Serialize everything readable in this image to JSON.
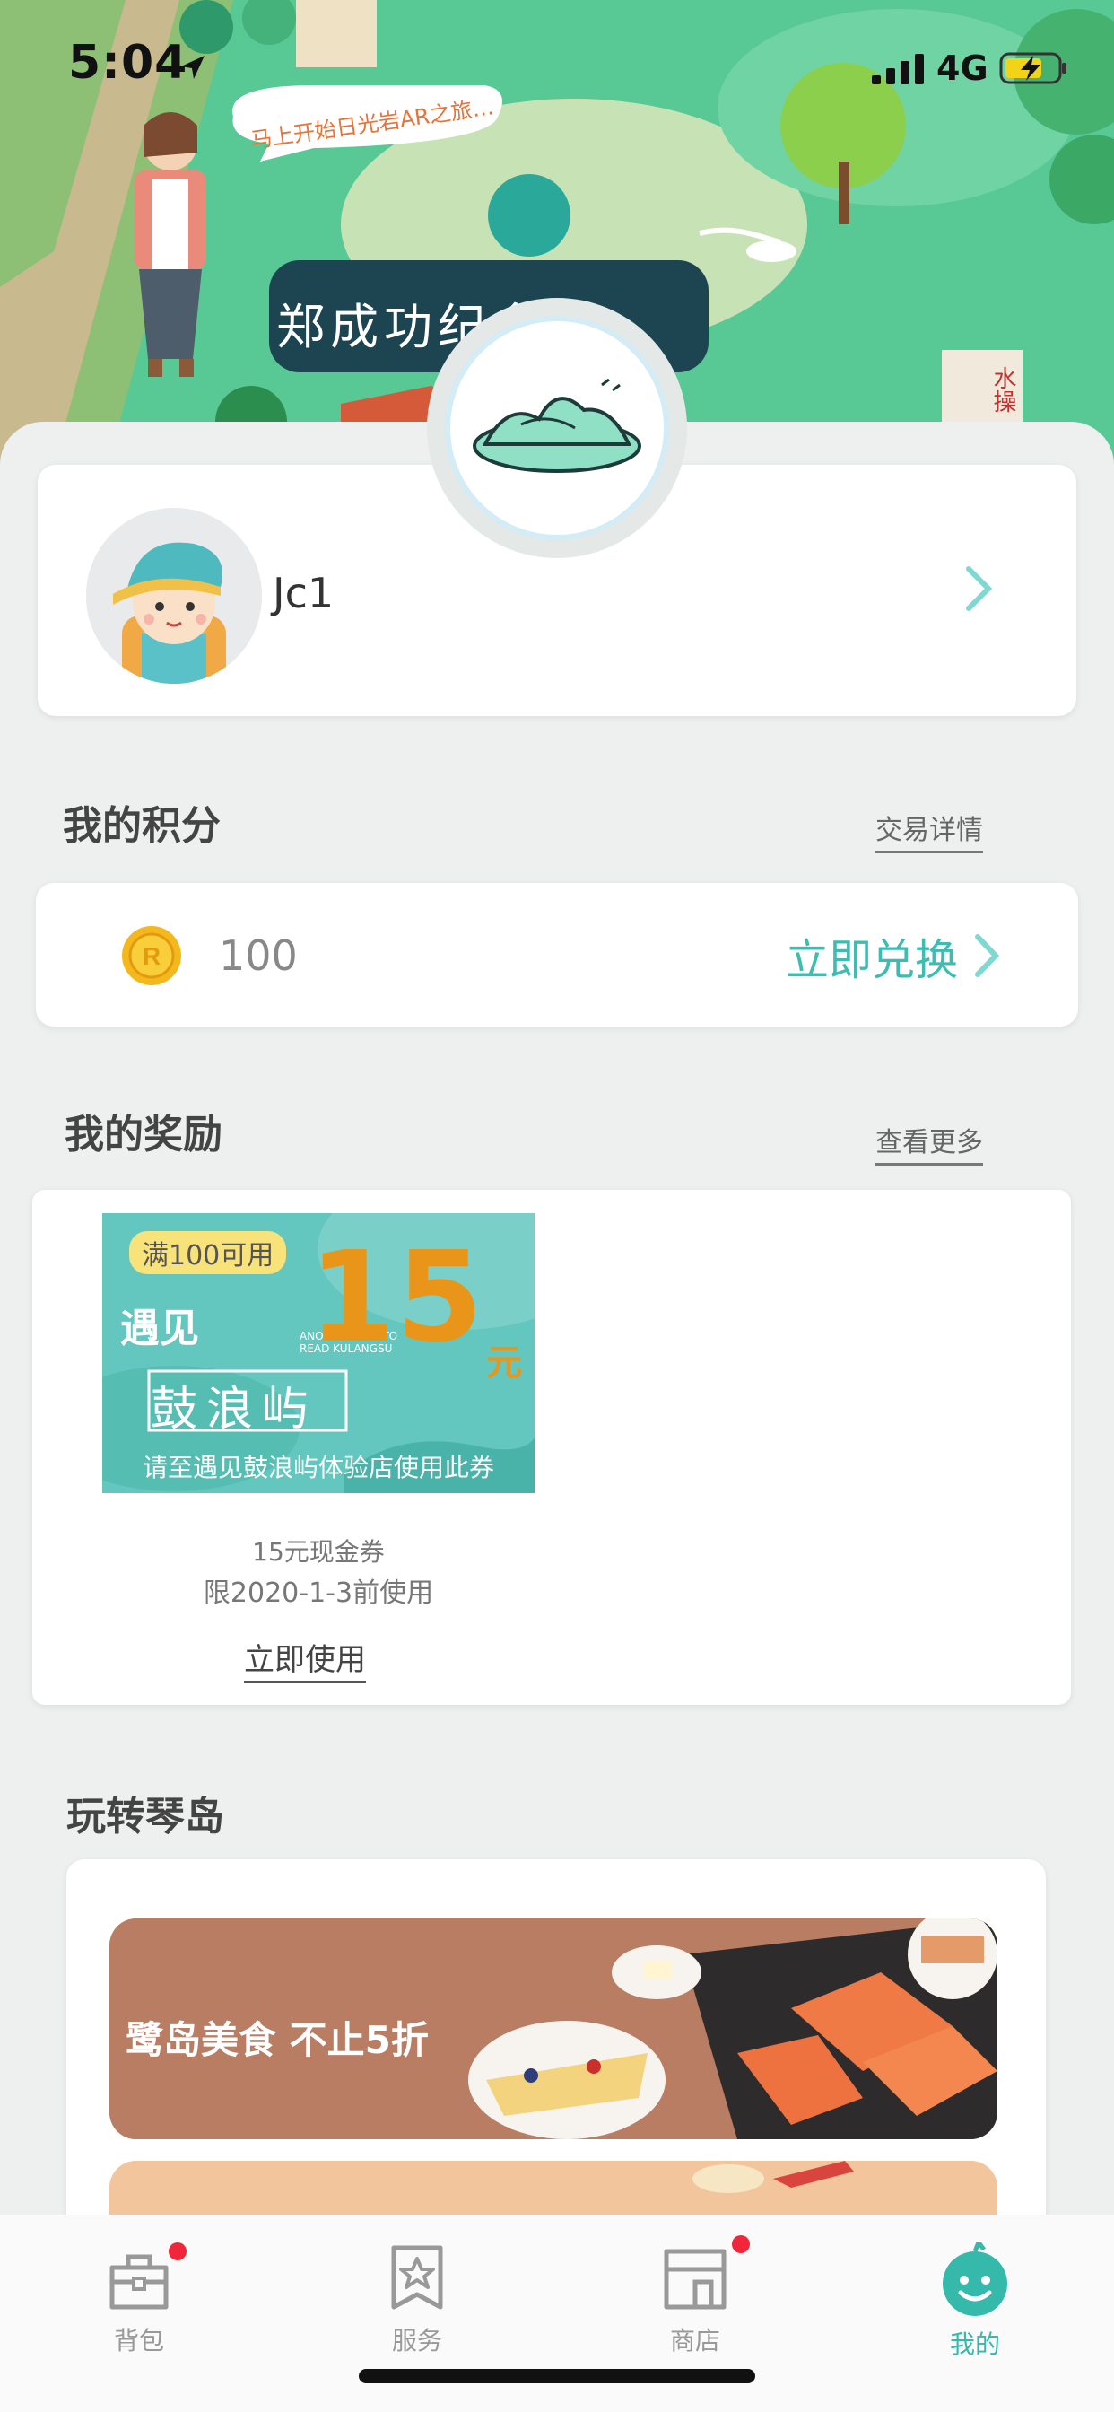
{
  "status_bar": {
    "time": "5:04",
    "network": "4G"
  },
  "header": {
    "speech_bubble": "马上开始日光岩AR之旅…",
    "museum_sign": "郑成功纪念馆",
    "side_sign": "水操"
  },
  "profile": {
    "username": "Jc1"
  },
  "points": {
    "section_title": "我的积分",
    "details_link": "交易详情",
    "value": "100",
    "redeem_label": "立即兑换"
  },
  "rewards": {
    "section_title": "我的奖励",
    "more_link": "查看更多",
    "coupon": {
      "condition": "满100可用",
      "amount": "15",
      "unit": "元",
      "brand_line1": "遇见",
      "brand_line2": "鼓浪屿",
      "sub_text": "ANOTHER WAY TO READ KULANGSU",
      "note": "请至遇见鼓浪屿体验店使用此券",
      "name": "15元现金券",
      "expiry": "限2020-1-3前使用",
      "use_label": "立即使用"
    }
  },
  "explore": {
    "section_title": "玩转琴岛",
    "banner1_text": "鹭岛美食 不止5折"
  },
  "tabbar": {
    "tabs": [
      {
        "label": "背包",
        "icon": "backpack-icon",
        "badge": true
      },
      {
        "label": "服务",
        "icon": "star-flag-icon",
        "badge": false
      },
      {
        "label": "商店",
        "icon": "store-icon",
        "badge": true
      },
      {
        "label": "我的",
        "icon": "smiley-icon",
        "badge": false,
        "active": true
      }
    ]
  },
  "colors": {
    "accent": "#3fbcb1",
    "badge": "#f0273a",
    "coupon_amount": "#e8951a"
  }
}
